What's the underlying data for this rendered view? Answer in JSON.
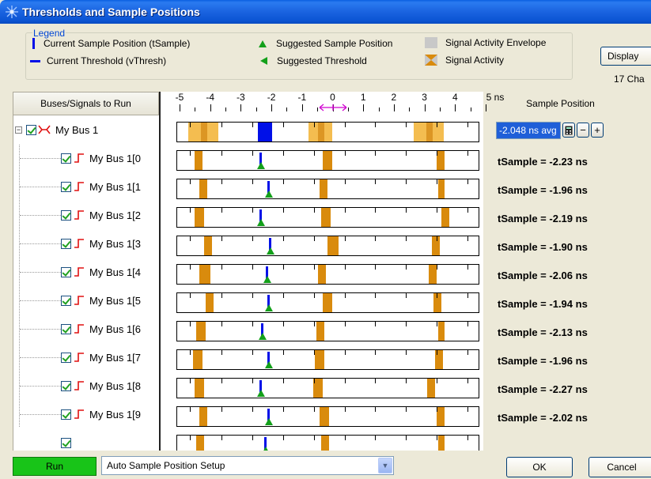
{
  "window": {
    "title": "Thresholds and Sample Positions"
  },
  "legend": {
    "label": "Legend",
    "items": {
      "sample_position": "Current Sample Position (tSample)",
      "threshold": "Current Threshold (vThresh)",
      "suggested_sample": "Suggested Sample Position",
      "suggested_threshold": "Suggested Threshold",
      "envelope": "Signal Activity Envelope",
      "activity": "Signal Activity"
    }
  },
  "display_button": "Display",
  "channel_text": "17 Cha",
  "tree": {
    "header": "Buses/Signals to Run",
    "bus": "My Bus 1",
    "signals": [
      "My Bus 1[0",
      "My Bus 1[1",
      "My Bus 1[2",
      "My Bus 1[3",
      "My Bus 1[4",
      "My Bus 1[5",
      "My Bus 1[6",
      "My Bus 1[7",
      "My Bus 1[8",
      "My Bus 1[9"
    ]
  },
  "ruler": {
    "unit": "ns",
    "ticks": [
      "-5",
      "-4",
      "-3",
      "-2",
      "-1",
      "0",
      "1",
      "2",
      "3",
      "4",
      "5 ns"
    ]
  },
  "sample_position": {
    "header": "Sample Position",
    "field_value": "-2.048 ns avg",
    "tsamples": [
      "tSample = -2.23 ns",
      "tSample = -1.96 ns",
      "tSample = -2.19 ns",
      "tSample = -1.90 ns",
      "tSample = -2.06 ns",
      "tSample = -1.94 ns",
      "tSample = -2.13 ns",
      "tSample = -1.96 ns",
      "tSample = -2.27 ns",
      "tSample = -2.02 ns"
    ]
  },
  "bottom": {
    "run": "Run",
    "setup": "Auto Sample Position Setup",
    "ok": "OK",
    "cancel": "Cancel"
  },
  "colors": {
    "title_bar": "#1a63e0",
    "envelope": "#f3b63e",
    "activity": "#d98b0d",
    "sample_marker": "#0010e8",
    "suggested": "#13a01a",
    "run_button": "#18c418"
  }
}
